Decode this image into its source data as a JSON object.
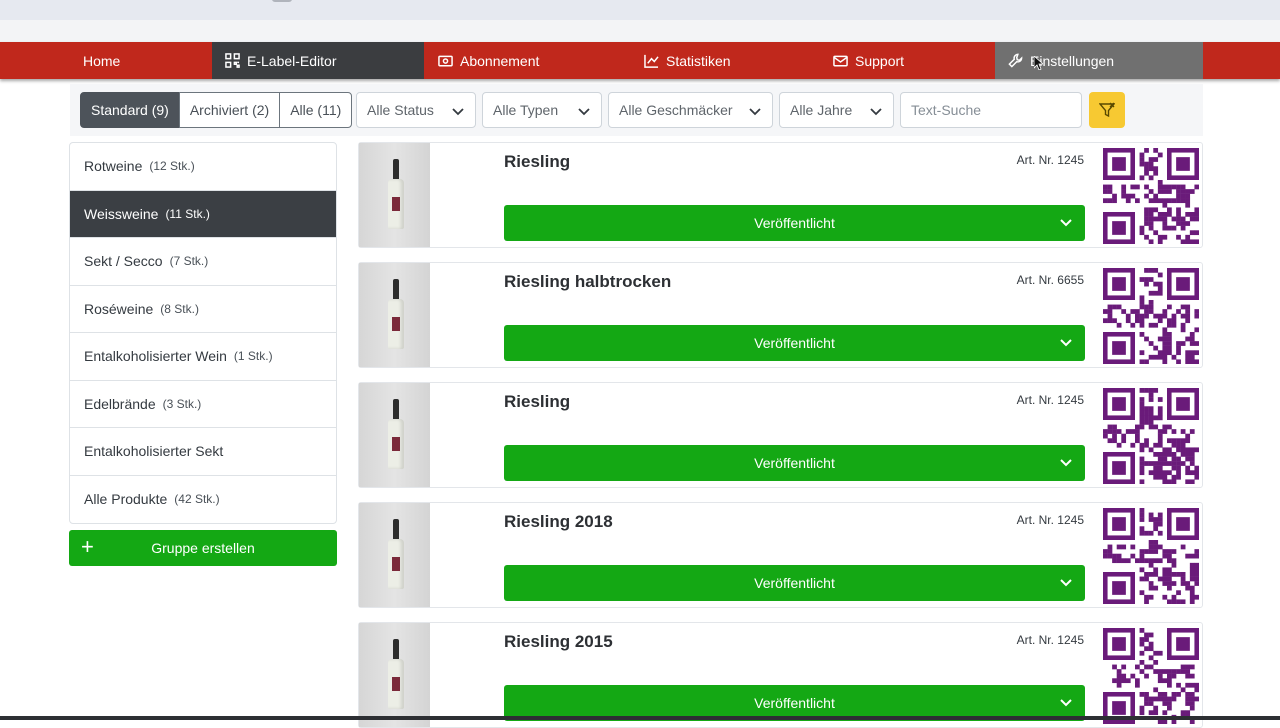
{
  "nav": {
    "home": "Home",
    "editor": "E-Label-Editor",
    "abonnement": "Abonnement",
    "statistiken": "Statistiken",
    "support": "Support",
    "einstellungen": "Einstellungen"
  },
  "filters": {
    "tabs": [
      "Standard (9)",
      "Archiviert (2)",
      "Alle (11)"
    ],
    "status": "Alle Status",
    "typen": "Alle Typen",
    "geschmaecker": "Alle Geschmäcker",
    "jahre": "Alle Jahre",
    "search_placeholder": "Text-Suche"
  },
  "sidebar": {
    "groups": [
      {
        "name": "Rotweine",
        "count": "(12 Stk.)"
      },
      {
        "name": "Weissweine",
        "count": "(11 Stk.)",
        "active": true
      },
      {
        "name": "Sekt / Secco",
        "count": "(7 Stk.)"
      },
      {
        "name": "Roséweine",
        "count": "(8 Stk.)"
      },
      {
        "name": "Entalkoholisierter Wein",
        "count": "(1 Stk.)"
      },
      {
        "name": "Edelbrände",
        "count": "(3 Stk.)"
      },
      {
        "name": "Entalkoholisierter Sekt",
        "count": ""
      },
      {
        "name": "Alle Produkte",
        "count": "(42 Stk.)"
      }
    ],
    "create_label": "Gruppe erstellen"
  },
  "products": [
    {
      "title": "Riesling",
      "art": "Art. Nr. 1245",
      "status": "Veröffentlicht"
    },
    {
      "title": "Riesling halbtrocken",
      "art": "Art. Nr. 6655",
      "status": "Veröffentlicht"
    },
    {
      "title": "Riesling",
      "art": "Art. Nr. 1245",
      "status": "Veröffentlicht"
    },
    {
      "title": "Riesling 2018",
      "art": "Art. Nr. 1245",
      "status": "Veröffentlicht"
    },
    {
      "title": "Riesling 2015",
      "art": "Art. Nr. 1245",
      "status": "Veröffentlicht"
    }
  ],
  "colors": {
    "navbar": "#c0281c",
    "nav_active": "#3b3d40",
    "published": "#14a814",
    "qr": "#6a1b7a",
    "filter_reset": "#f7c932"
  }
}
